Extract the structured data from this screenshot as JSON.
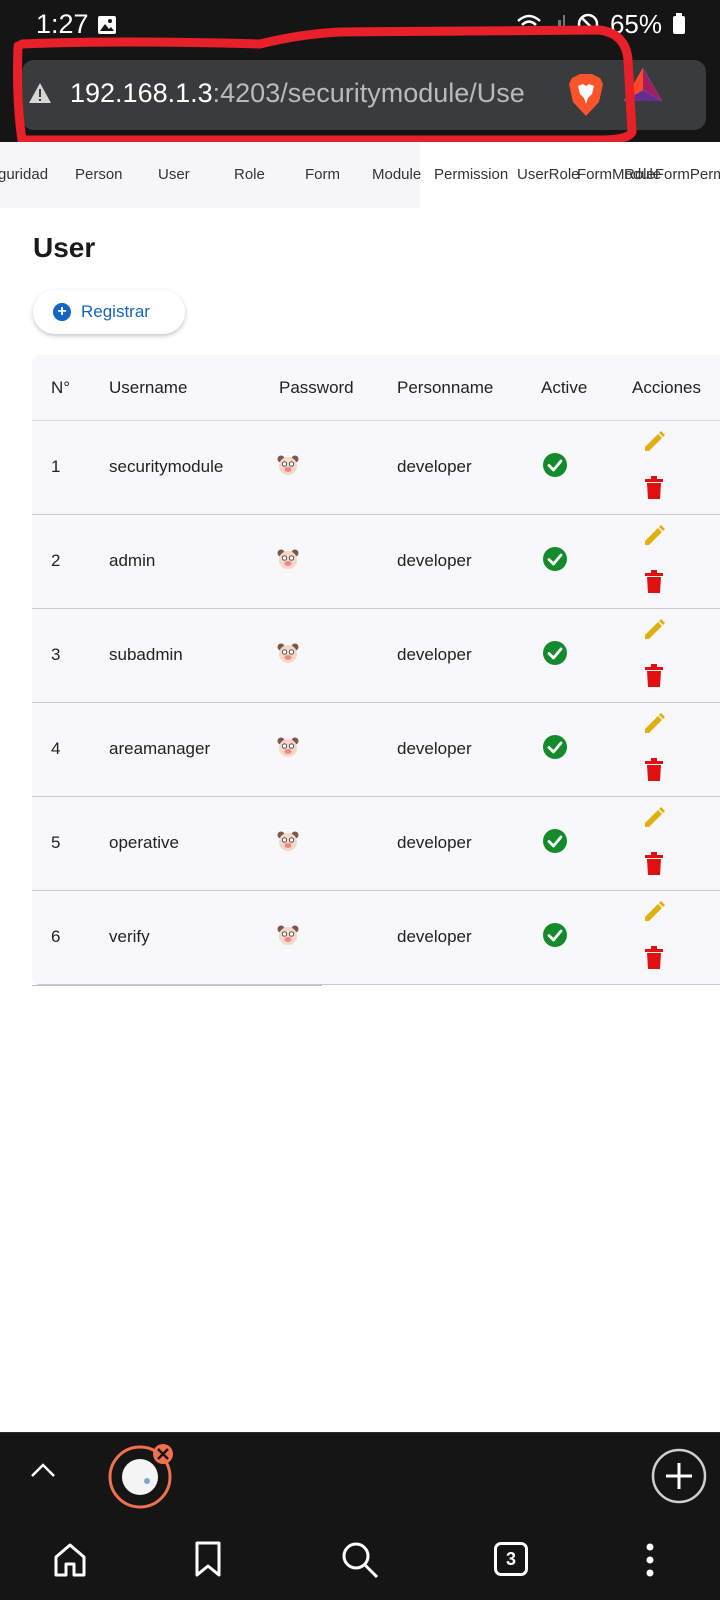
{
  "status_bar": {
    "time": "1:27",
    "battery": "65%"
  },
  "browser": {
    "url_host": "192.168.1.3",
    "url_path": ":4203/securitymodule/Use",
    "tabs_count": "3",
    "colors": {
      "brave": "#fb542b",
      "annotation": "#e8202a"
    }
  },
  "menu": {
    "items": [
      "guridad",
      "Person",
      "User",
      "Role",
      "Form",
      "Module",
      "Permission",
      "UserRole",
      "FormModule",
      "RoleFormPerm"
    ]
  },
  "main": {
    "title": "User",
    "register_label": "Registrar",
    "table": {
      "headers": [
        "N°",
        "Username",
        "Password",
        "Personname",
        "Active",
        "Acciones"
      ],
      "rows": [
        {
          "n": "1",
          "username": "securitymodule",
          "personname": "developer",
          "active": true
        },
        {
          "n": "2",
          "username": "admin",
          "personname": "developer",
          "active": true
        },
        {
          "n": "3",
          "username": "subadmin",
          "personname": "developer",
          "active": true
        },
        {
          "n": "4",
          "username": "areamanager",
          "personname": "developer",
          "active": true
        },
        {
          "n": "5",
          "username": "operative",
          "personname": "developer",
          "active": true
        },
        {
          "n": "6",
          "username": "verify",
          "personname": "developer",
          "active": true
        }
      ]
    },
    "colors": {
      "edit": "#e0b010",
      "delete": "#e01010",
      "active": "#138a2c",
      "register": "#1565c0"
    }
  }
}
